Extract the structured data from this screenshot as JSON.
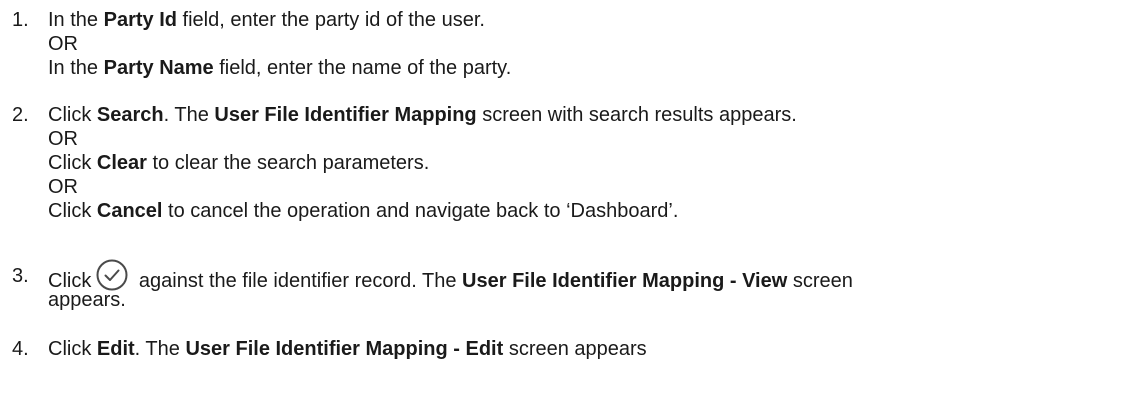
{
  "steps": [
    {
      "number": "1.",
      "line1": {
        "t1": "In the ",
        "b1": "Party Id",
        "t2": " field, enter the party id of the user."
      },
      "or1": "OR",
      "line2": {
        "t1": "In the ",
        "b1": "Party Name",
        "t2": " field, enter the name of the party."
      }
    },
    {
      "number": "2.",
      "line1": {
        "t1": "Click ",
        "b1": "Search",
        "t2": ". The ",
        "b2": "User File Identifier Mapping",
        "t3": " screen with search results appears."
      },
      "or1": "OR",
      "line2": {
        "t1": "Click ",
        "b1": "Clear",
        "t2": " to clear the search parameters."
      },
      "or2": "OR",
      "line3": {
        "t1": "Click ",
        "b1": "Cancel",
        "t2": " to cancel the operation and navigate back to ‘Dashboard’."
      }
    },
    {
      "number": "3.",
      "line1": {
        "t1": "Click",
        "icon": "check-circle-icon",
        "t2": " against the file identifier record. The ",
        "b1": "User File Identifier Mapping - View",
        "t3": " screen"
      },
      "line2": {
        "t1": "appears."
      }
    },
    {
      "number": "4.",
      "line1": {
        "t1": "Click ",
        "b1": "Edit",
        "t2": ". The ",
        "b2": "User File Identifier Mapping - Edit",
        "t3": " screen appears"
      }
    }
  ],
  "colors": {
    "text": "#1a1a1a",
    "icon_stroke": "#4a4a4a"
  }
}
